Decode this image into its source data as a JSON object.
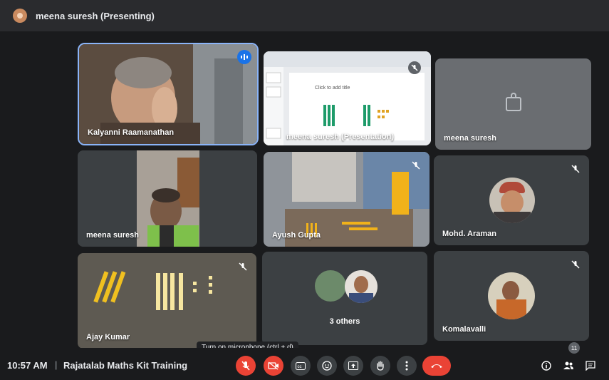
{
  "presenter_bar": {
    "title": "meena suresh (Presenting)"
  },
  "tiles": {
    "kalyanni": {
      "name": "Kalyanni Raamanathan"
    },
    "presentation": {
      "name": "meena suresh (Presentation)",
      "slide_placeholder": "Click to add title"
    },
    "meena_self": {
      "name": "meena suresh"
    },
    "meena_cam": {
      "name": "meena suresh"
    },
    "ayush": {
      "name": "Ayush Gupta"
    },
    "mohd": {
      "name": "Mohd. Araman"
    },
    "ajay": {
      "name": "Ajay Kumar"
    },
    "others": {
      "name": "3 others"
    },
    "komalavalli": {
      "name": "Komalavalli"
    }
  },
  "bottom_bar": {
    "time": "10:57 AM",
    "separator": "|",
    "meeting_title": "Rajatalab Maths Kit Training",
    "tooltip": "Turn on microphone (ctrl + d)",
    "participants_count": "11"
  },
  "colors": {
    "accent": "#8ab4f8",
    "danger": "#ea4335",
    "tile_bg": "#3c4043",
    "speaking": "#1a73e8"
  },
  "icons": [
    "mic-off-icon",
    "camera-off-icon",
    "captions-icon",
    "emoji-icon",
    "present-icon",
    "raise-hand-icon",
    "more-options-icon",
    "hang-up-icon",
    "info-icon",
    "people-icon",
    "chat-icon",
    "lock-icon",
    "speaking-indicator-icon"
  ]
}
